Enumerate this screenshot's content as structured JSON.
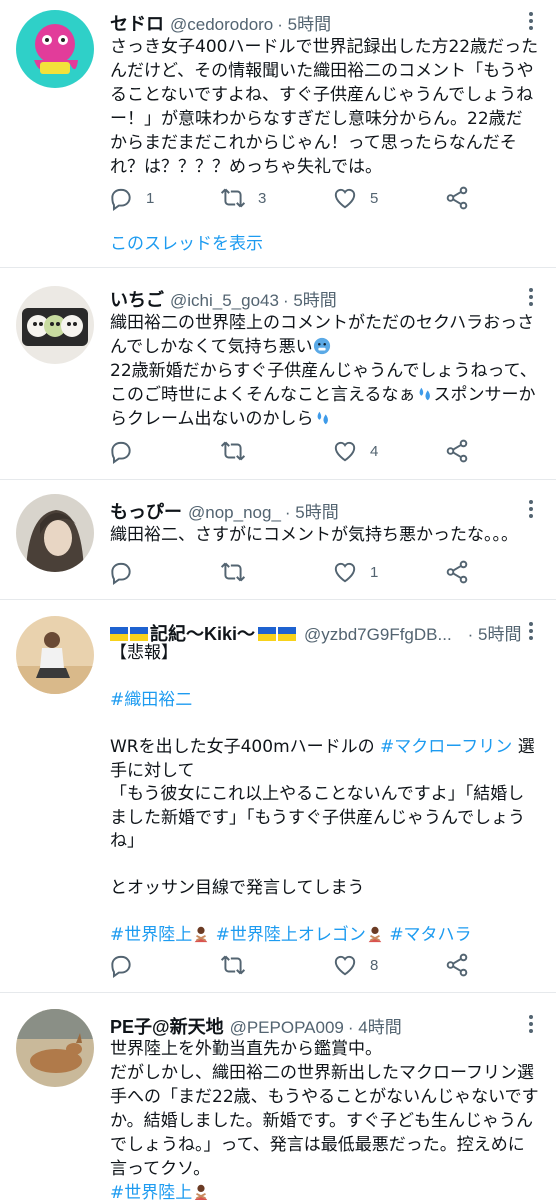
{
  "colors": {
    "link": "#1d9bf0",
    "muted": "#536471",
    "text": "#0f1419",
    "border": "#e6e9ec"
  },
  "tweets": [
    {
      "name": "セドロ",
      "handle": "@cedorodoro",
      "time": "· 5時間",
      "lines": [
        "さっき女子400ハードルで世界記録出した方22歳だった",
        "んだけど、その情報聞いた織田裕二のコメント「もうや",
        "ることないですよね、すぐ子供産んじゃうんでしょうね",
        "ー！」が意味わからなすぎだし意味分からん。22歳だ",
        "からまだまだこれからじゃん！って思ったらなんだそ",
        "れ？は？？？？めっちゃ失礼では。"
      ],
      "reply_count": "1",
      "retweet_count": "3",
      "like_count": "5",
      "thread_link": "このスレッドを表示"
    },
    {
      "name": "いちご",
      "handle": "@ichi_5_go43",
      "time": "· 5時間",
      "lines": [
        "織田裕二の世界陸上のコメントがただのセクハラおっさ",
        "んでしかなくて気持ち悪い",
        "22歳新婚だからすぐ子供産んじゃうんでしょうねって、",
        "このご時世によくそんなこと言えるなぁ",
        "スポンサーか",
        "らクレーム出ないのかしら"
      ],
      "reply_count": "",
      "retweet_count": "",
      "like_count": "4"
    },
    {
      "name": "もっぴー",
      "handle": "@nop_nog_",
      "time": "· 5時間",
      "lines": [
        "織田裕二、さすがにコメントが気持ち悪かったな。。。"
      ],
      "reply_count": "",
      "retweet_count": "",
      "like_count": "1"
    },
    {
      "name": "記紀〜Kiki〜",
      "handle": "@yzbd7G9FfgDB...",
      "time": "· 5時間",
      "lines": [
        "【悲報】",
        "",
        "#織田裕二",
        "",
        "WRを出した女子400mハードルの",
        "#マクローフリン",
        "選",
        "手に対して",
        "「もう彼女にこれ以上やることないんですよ」「結婚し",
        "ました新婚です」「もうすぐ子供産んじゃうんでしょう",
        "ね」",
        "",
        "とオッサン目線で発言してしまう",
        "",
        "#世界陸上",
        "#世界陸上オレゴン",
        "#マタハラ"
      ],
      "reply_count": "",
      "retweet_count": "",
      "like_count": "8"
    },
    {
      "name": "PE子@新天地",
      "handle": "@PEPOPA009",
      "time": "· 4時間",
      "lines": [
        "世界陸上を外勤当直先から鑑賞中。",
        "だがしかし、織田裕二の世界新出したマクローフリン選",
        "手への「まだ22歳、もうやることがないんじゃないです",
        "か。結婚しました。新婚です。すぐ子ども生んじゃうん",
        "でしょうね。」って、発言は最低最悪だった。控えめに",
        "言ってクソ。",
        "#世界陸上"
      ]
    }
  ]
}
